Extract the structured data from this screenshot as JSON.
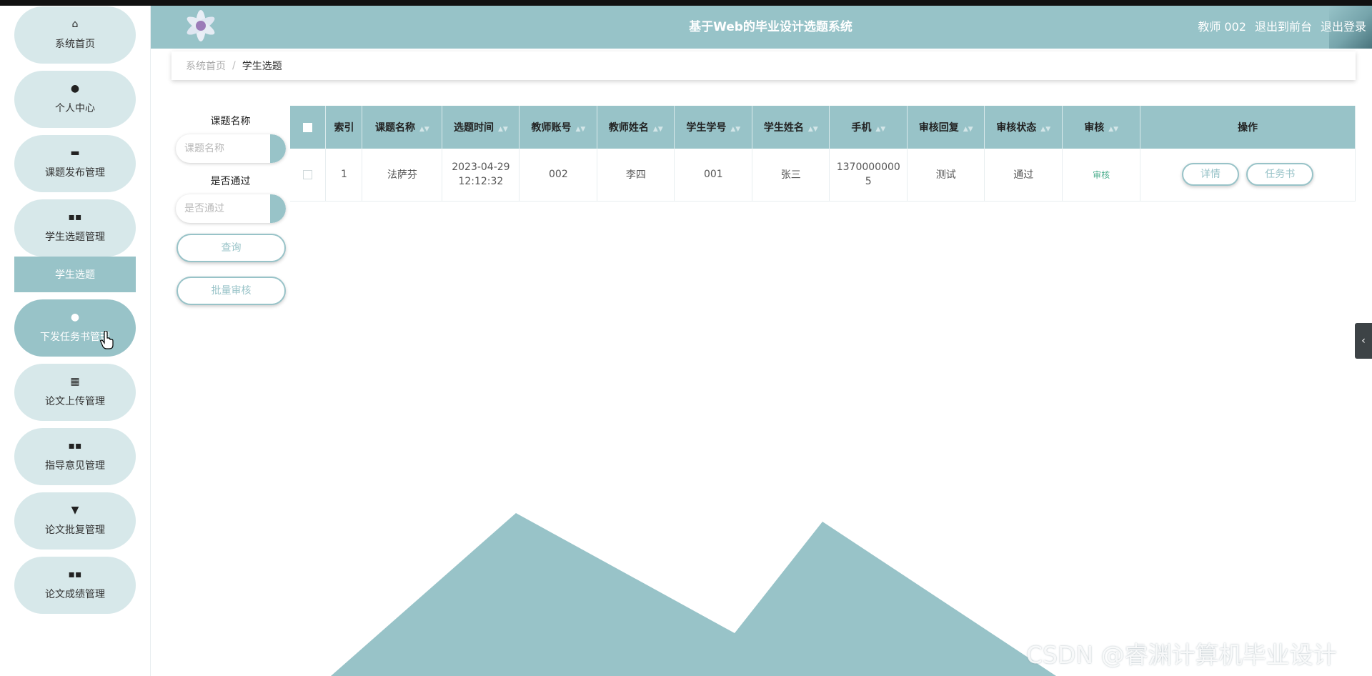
{
  "header": {
    "title": "基于Web的毕业设计选题系统",
    "user": "教师 002",
    "to_front": "退出到前台",
    "logout": "退出登录"
  },
  "sidebar": {
    "items": [
      {
        "label": "系统首页",
        "icon": "home-icon"
      },
      {
        "label": "个人中心",
        "icon": "user-icon"
      },
      {
        "label": "课题发布管理",
        "icon": "book-icon"
      },
      {
        "label": "学生选题管理",
        "icon": "grid-icon"
      },
      {
        "label": "下发任务书管理",
        "icon": "user-icon"
      },
      {
        "label": "论文上传管理",
        "icon": "apps-icon"
      },
      {
        "label": "指导意见管理",
        "icon": "grid-icon"
      },
      {
        "label": "论文批复管理",
        "icon": "pen-icon"
      },
      {
        "label": "论文成绩管理",
        "icon": "grid-icon"
      }
    ],
    "sub_item": "学生选题"
  },
  "breadcrumb": {
    "home": "系统首页",
    "separator": "/",
    "current": "学生选题"
  },
  "filters": {
    "topic_label": "课题名称",
    "topic_placeholder": "课题名称",
    "passed_label": "是否通过",
    "passed_placeholder": "是否通过",
    "query_button": "查询",
    "batch_button": "批量审核"
  },
  "table": {
    "headers": {
      "index": "索引",
      "topic": "课题名称",
      "time": "选题时间",
      "teacher_id": "教师账号",
      "teacher_name": "教师姓名",
      "student_id": "学生学号",
      "student_name": "学生姓名",
      "phone": "手机",
      "reply": "审核回复",
      "status": "审核状态",
      "audit": "审核",
      "ops": "操作"
    },
    "rows": [
      {
        "index": "1",
        "topic": "法萨芬",
        "time_date": "2023-04-29",
        "time_clock": "12:12:32",
        "teacher_id": "002",
        "teacher_name": "李四",
        "student_id": "001",
        "student_name": "张三",
        "phone_a": "1370000000",
        "phone_b": "5",
        "reply": "测试",
        "status": "通过",
        "audit": "审核",
        "detail_btn": "详情",
        "task_btn": "任务书"
      }
    ]
  },
  "watermark": "CSDN @睿渊计算机毕业设计",
  "colors": {
    "accent": "#98c3c8",
    "nav_bg": "#d7e8ea",
    "audit_link": "#4dae8e"
  }
}
